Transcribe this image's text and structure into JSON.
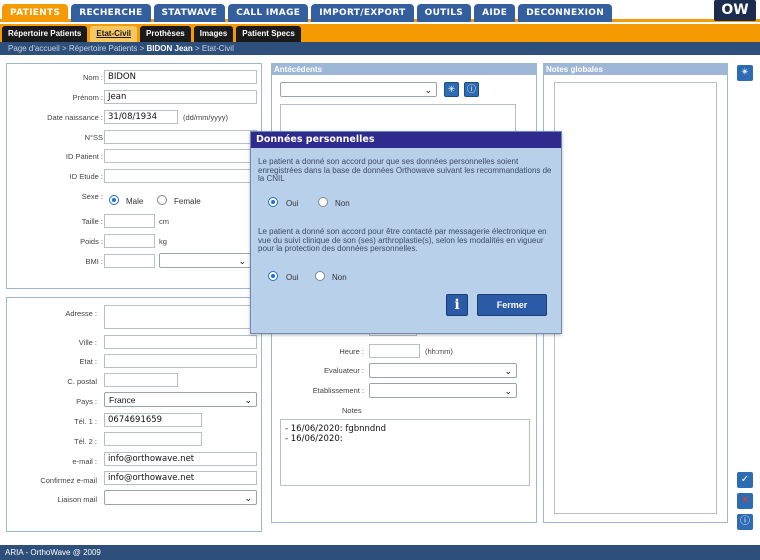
{
  "topnav": [
    "PATIENTS",
    "RECHERCHE",
    "STATWAVE",
    "CALL IMAGE",
    "IMPORT/EXPORT",
    "OUTILS",
    "AIDE",
    "DECONNEXION"
  ],
  "logo": "OW",
  "subnav": [
    "Répertoire Patients",
    "Etat-Civil",
    "Prothèses",
    "Images",
    "Patient Specs"
  ],
  "breadcrumb": {
    "pre": "Page d'accueil > Répertoire Patients > ",
    "bold": "BIDON Jean",
    "post": " > Etat-Civil"
  },
  "identity": {
    "nom_label": "Nom :",
    "nom": "BIDON",
    "prenom_label": "Prénom :",
    "prenom": "Jean",
    "dob_label": "Date naissance :",
    "dob": "31/08/1934",
    "dob_hint": "(dd/mm/yyyy)",
    "nss_label": "N°SS",
    "idpatient_label": "ID Patient :",
    "idetude_label": "ID Etude :",
    "sexe_label": "Sexe :",
    "male": "Male",
    "female": "Female",
    "taille_label": "Taille :",
    "taille_unit": "cm",
    "poids_label": "Poids :",
    "poids_unit": "kg",
    "bmi_label": "BMI :"
  },
  "address": {
    "adresse_label": "Adresse :",
    "ville_label": "Ville :",
    "etat_label": "Etat :",
    "cp_label": "C. postal",
    "pays_label": "Pays :",
    "pays": "France",
    "tel1_label": "Tél. 1 :",
    "tel1": "0674691659",
    "tel2_label": "Tél. 2 :",
    "email_label": "e-mail :",
    "email": "info@orthowave.net",
    "email_confirm_label": "Confirmez e-mail",
    "email_confirm": "info@orthowave.net",
    "liaison_label": "Liaison mail"
  },
  "antecedents": {
    "title": "Antécédents",
    "heure_label": "Heure :",
    "heure_hint": "(hh:mm)",
    "evaluateur_label": "Evaluateur :",
    "etablissement_label": "Etablissement :",
    "notes_label": "Notes",
    "notes_lines": [
      "- 16/06/2020: fgbnndnd",
      "- 16/06/2020:"
    ]
  },
  "notes_globales": {
    "title": "Notes globales"
  },
  "modal": {
    "title": "Données personnelles",
    "text1": "Le patient a donné son accord pour que ses données personnelles soient enregistrées dans la base de données Orthowave suivant les recommandations de la CNIL",
    "text2": "Le patient a donné son accord pour être contacté par messagerie électronique en vue du suivi clinique de son (ses) arthroplastie(s), selon les modalités en vigueur pour la protection des données personnelles.",
    "oui": "Oui",
    "non": "Non",
    "info_label": "i",
    "close_label": "Fermer"
  },
  "footer": "ARIA - OrthoWave @ 2009",
  "colors": {
    "orange": "#f59a00",
    "navy": "#2d4f7a",
    "modal_head": "#2e2a8e"
  }
}
